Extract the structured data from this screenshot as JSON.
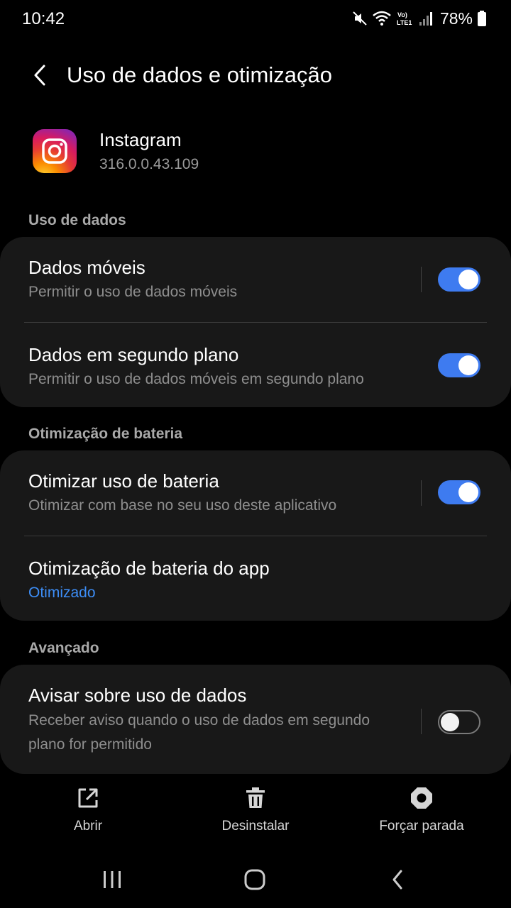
{
  "status_bar": {
    "time": "10:42",
    "battery": "78%",
    "icons": [
      "mute-icon",
      "wifi-icon",
      "volte-lte-icon",
      "signal-icon",
      "battery-icon"
    ]
  },
  "header": {
    "title": "Uso de dados e otimização",
    "back_icon": "chevron-left-icon"
  },
  "app": {
    "name": "Instagram",
    "version": "316.0.0.43.109",
    "icon": "instagram-icon"
  },
  "sections": {
    "data_usage": {
      "label": "Uso de dados",
      "mobile_data": {
        "title": "Dados móveis",
        "subtitle": "Permitir o uso de dados móveis",
        "enabled": true
      },
      "background_data": {
        "title": "Dados em segundo plano",
        "subtitle": "Permitir o uso de dados móveis em segundo plano",
        "enabled": true
      }
    },
    "battery": {
      "label": "Otimização de bateria",
      "optimize": {
        "title": "Otimizar uso de bateria",
        "subtitle": "Otimizar com base no seu uso deste aplicativo",
        "enabled": true
      },
      "app_optimization": {
        "title": "Otimização de bateria do app",
        "value": "Otimizado"
      }
    },
    "advanced": {
      "label": "Avançado",
      "data_warning": {
        "title": "Avisar sobre uso de dados",
        "subtitle": "Receber aviso quando o uso de dados em segundo plano for permitido",
        "enabled": false
      }
    }
  },
  "actions": {
    "open": {
      "label": "Abrir",
      "icon": "open-external-icon"
    },
    "uninstall": {
      "label": "Desinstalar",
      "icon": "trash-icon"
    },
    "force_stop": {
      "label": "Forçar parada",
      "icon": "stop-icon"
    }
  },
  "nav": {
    "recents": "recents-icon",
    "home": "home-icon",
    "back": "back-icon"
  },
  "colors": {
    "accent": "#3e7bf0",
    "link": "#3d8ef7",
    "card": "#181818",
    "background": "#000000"
  }
}
